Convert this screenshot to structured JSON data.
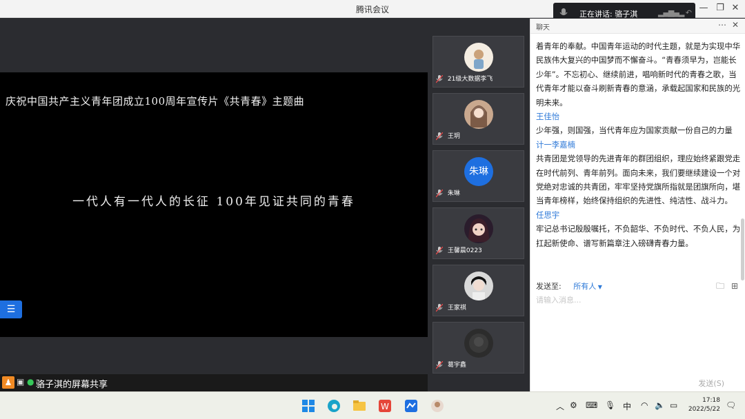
{
  "app": {
    "title": "腾讯会议"
  },
  "speaking": {
    "text": "正在讲话: 骆子淇"
  },
  "share": {
    "title": "庆祝中国共产主义青年团成立100周年宣传片《共青春》主题曲",
    "subtitle": "一代人有一代人的长征  100年见证共同的青春",
    "presenter_label": "骆子淇的屏幕共享"
  },
  "gallery": [
    {
      "name": "21级大数据李飞",
      "avatar": "illustration"
    },
    {
      "name": "王玥",
      "avatar": "photo-girl"
    },
    {
      "name": "朱琳",
      "avatar": "text",
      "avatar_text": "朱琳",
      "avatar_color": "#1e6fe0"
    },
    {
      "name": "王馨晨0223",
      "avatar": "anime"
    },
    {
      "name": "王家祺",
      "avatar": "photo-boy"
    },
    {
      "name": "葛宇鑫",
      "avatar": "dark"
    }
  ],
  "chat": {
    "header": "聊天",
    "messages": [
      {
        "text": "着青年的奉献。中国青年运动的时代主题，就是为实现中华民族伟大复兴的中国梦而不懈奋斗。“青春须早为，岂能长少年”。不忘初心、继续前进，唱响新时代的青春之歌，当代青年才能以奋斗刷新青春的意涵，承载起国家和民族的光明未来。"
      },
      {
        "name": "王佳怡",
        "text": "少年强，则国强，当代青年应为国家贡献一份自己的力量"
      },
      {
        "name": "计一李嘉楠",
        "text": "共青团是党领导的先进青年的群团组织，理应始终紧跟党走在时代前列、青年前列。面向未来，我们要继续建设一个对党绝对忠诚的共青团，牢牢坚持党旗所指就是团旗所向，堪当青年榜样，始终保持组织的先进性、纯洁性、战斗力。"
      },
      {
        "name": "任思宇",
        "text": "牢记总书记殷殷嘱托，不负韶华、不负时代、不负人民，为扛起新使命、谱写新篇章注入磅礴青春力量。"
      }
    ],
    "send_to_label": "发送至:",
    "send_to_value": "所有人",
    "input_placeholder": "请输入消息...",
    "send_button": "发送(S)"
  },
  "taskbar": {
    "tray_lang": "中",
    "time": "17:18",
    "date": "2022/5/22"
  }
}
